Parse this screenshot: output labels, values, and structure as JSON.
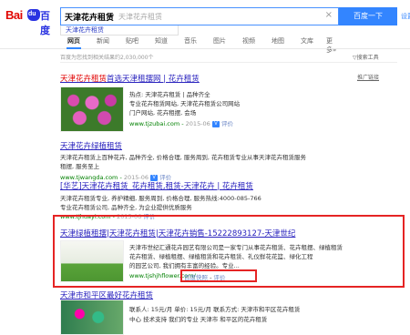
{
  "header": {
    "logo": {
      "left": "Bai",
      "paw": "du",
      "right": "百度"
    },
    "query": "天津花卉租赁",
    "query_hint": "天津花卉租赁",
    "clear_icon": "close-icon",
    "search_button": "百度一下",
    "top_link": "设置"
  },
  "suggestion": "天津花卉租赁",
  "tabs": [
    "网页",
    "新闻",
    "贴吧",
    "知道",
    "音乐",
    "图片",
    "视频",
    "地图",
    "文库",
    "更多»"
  ],
  "result_count": "百度为您找到相关结果约2,030,000个",
  "search_tools": "搜索工具",
  "promo_link": "推广链接",
  "results": [
    {
      "title_parts": [
        "天津花卉租赁",
        "首选天津租摆网 | 花卉租赁"
      ],
      "lines": [
        "热点: 天津花卉租赁 | 品种齐全",
        "专业花卉租赁网站, 天津花卉租赁公司网站",
        "门户网站, 花卉租摆, 会场"
      ],
      "url": "www.tjzubai.com",
      "date": "2015-06",
      "extra": "评价"
    },
    {
      "title": "天津花卉绿植租赁",
      "lines": [
        "天津花卉租赁上百种花卉, 品种齐全, 价格合理, 服务周到, 花卉租赁专业从事天津花卉租赁服务",
        "租摆, 服务至上"
      ],
      "url": "www.tjwangda.com",
      "date": "2015-06",
      "extra": "评价"
    },
    {
      "title": "[华艺]天津花卉租赁_花卉租赁,租赁-天津花卉 | 花卉租赁",
      "lines": [
        "天津花卉租赁专业, 养护精细, 服务周到, 价格合理, 服务热线:4000-085-766",
        "专业花卉租赁公司, 品种齐全, 为企业提供优质服务"
      ],
      "url": "www.tjhuayi.com",
      "date": "2015-06",
      "extra": "评价"
    },
    {
      "title": "天津绿植租摆|天津花卉租赁|天津花卉销售-15222893127-天津世纪",
      "lines": [
        "天津市世纪汇通花卉园艺有限公司是一家专门从事花卉租赁、花卉租摆、绿植租赁",
        "花卉租赁、绿植租摆、绿植租赁和花卉租赁、礼仪鲜花花篮、绿化工程",
        "的园艺公司, 我们拥有丰富的经验。专业..."
      ],
      "url": "www.tjshjhflower.com/",
      "ad_label": "百度快照",
      "extra": "评价"
    },
    {
      "title": "天津市和平区最好花卉租赁",
      "lines": [
        "联系人: 15元/月 单价: 15元/月 联系方式: 天津市和平区花卉租赁",
        "中心 技术支持 我们的专业 天津市 和平区的花卉租赁"
      ]
    }
  ]
}
